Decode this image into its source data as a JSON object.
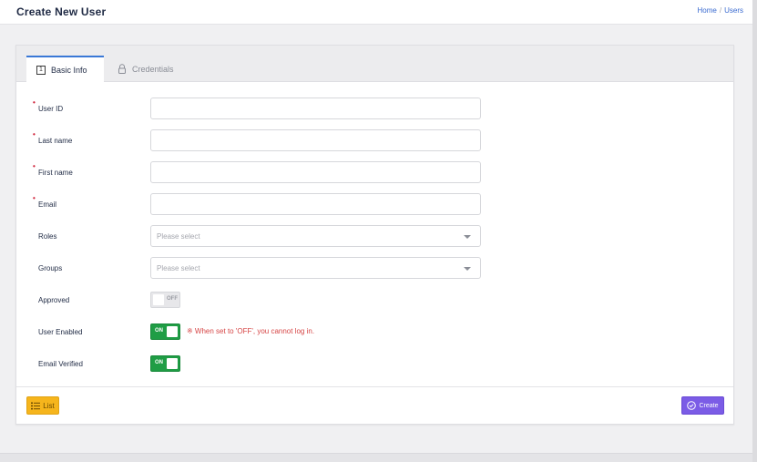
{
  "header": {
    "title": "Create New User",
    "breadcrumb": [
      "Home",
      "Users"
    ],
    "breadcrumb_separator": "/"
  },
  "tabs": [
    {
      "label": "Basic Info",
      "icon": "document-number-icon",
      "icon_text": "1",
      "active": true
    },
    {
      "label": "Credentials",
      "icon": "lock-icon",
      "active": false
    }
  ],
  "form": {
    "required_mark": "•",
    "user_id": {
      "label": "User ID",
      "value": "",
      "required": true
    },
    "last_name": {
      "label": "Last name",
      "value": "",
      "required": true
    },
    "first_name": {
      "label": "First name",
      "value": "",
      "required": true
    },
    "email": {
      "label": "Email",
      "value": "",
      "required": true
    },
    "roles": {
      "label": "Roles",
      "placeholder": "Please select"
    },
    "groups": {
      "label": "Groups",
      "placeholder": "Please select"
    },
    "approved": {
      "label": "Approved",
      "state": "OFF"
    },
    "user_enabled": {
      "label": "User Enabled",
      "state": "ON",
      "note": "※ When set to 'OFF', you cannot log in."
    },
    "email_verified": {
      "label": "Email Verified",
      "state": "ON"
    }
  },
  "footer": {
    "list_label": "List",
    "create_label": "Create"
  },
  "colors": {
    "accent_tab": "#3a78d6",
    "toggle_on": "#1f9d45",
    "list_button": "#f6b51c",
    "create_button": "#7b5ce6",
    "required": "#d0243c",
    "note": "#d64545"
  }
}
